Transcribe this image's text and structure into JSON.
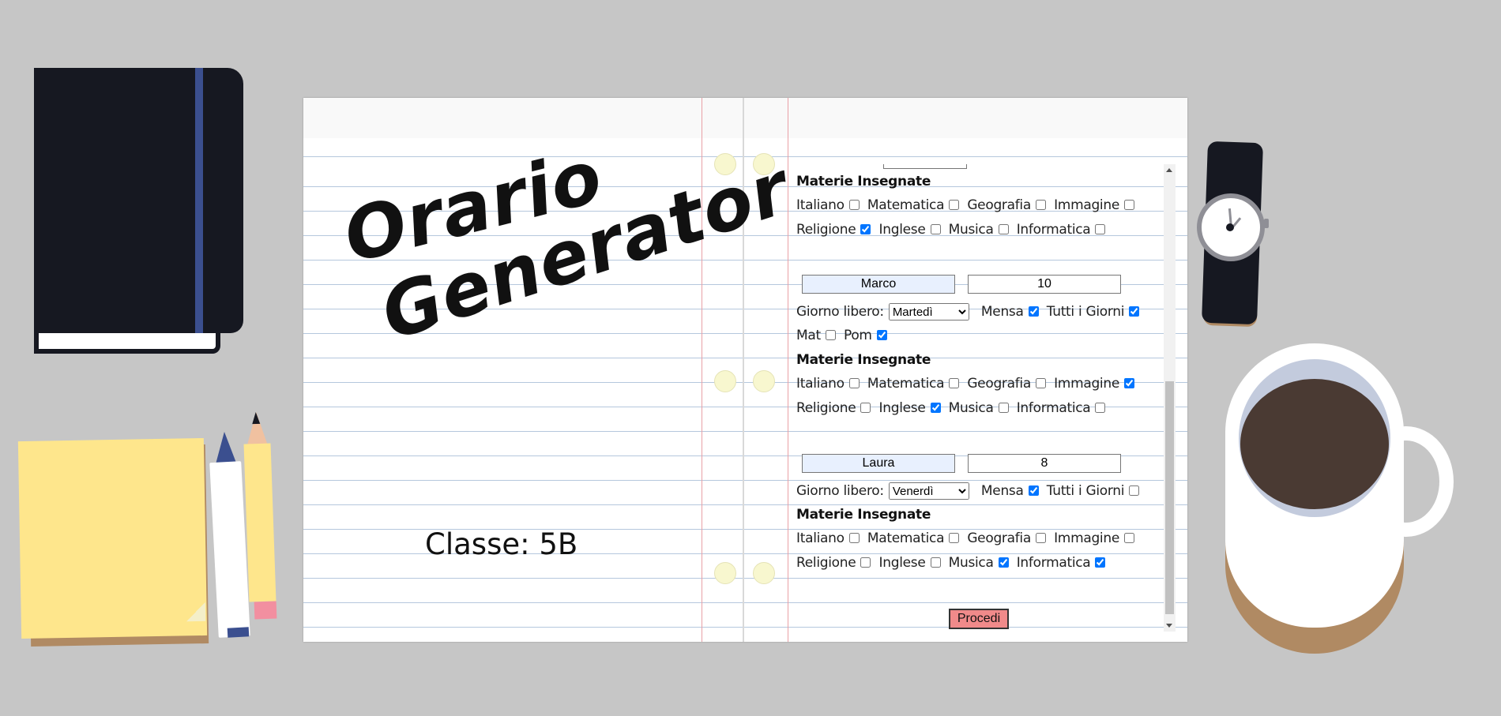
{
  "header": {
    "title_line1": "Orario",
    "title_line2": "Generator",
    "class_label": "Classe: 5B"
  },
  "labels": {
    "free_day": "Giorno libero:",
    "canteen": "Mensa",
    "all_days": "Tutti i Giorni",
    "morning": "Mat",
    "afternoon": "Pom",
    "subjects_title": "Materie Insegnate"
  },
  "subjects": [
    "Italiano",
    "Matematica",
    "Geografia",
    "Immagine",
    "Religione",
    "Inglese",
    "Musica",
    "Informatica"
  ],
  "teachers": [
    {
      "name": "",
      "hours": "",
      "free_day": "",
      "subjects_checked": [
        false,
        false,
        false,
        false,
        true,
        false,
        false,
        false
      ]
    },
    {
      "name": "Marco",
      "hours": "10",
      "free_day": "Martedì",
      "canteen": true,
      "all_days": true,
      "morning": false,
      "afternoon": true,
      "subjects_checked": [
        false,
        false,
        false,
        true,
        false,
        true,
        false,
        false
      ]
    },
    {
      "name": "Laura",
      "hours": "8",
      "free_day": "Venerdì",
      "canteen": true,
      "all_days": false,
      "subjects_checked": [
        false,
        false,
        false,
        false,
        false,
        false,
        true,
        true
      ]
    }
  ],
  "submit_label": "Procedi",
  "colors": {
    "background": "#c6c6c6",
    "paper_line": "#b5c7dd",
    "margin_line": "#e9a0a6",
    "submit_button": "#f08a8a",
    "name_field": "#e8f0fe"
  }
}
